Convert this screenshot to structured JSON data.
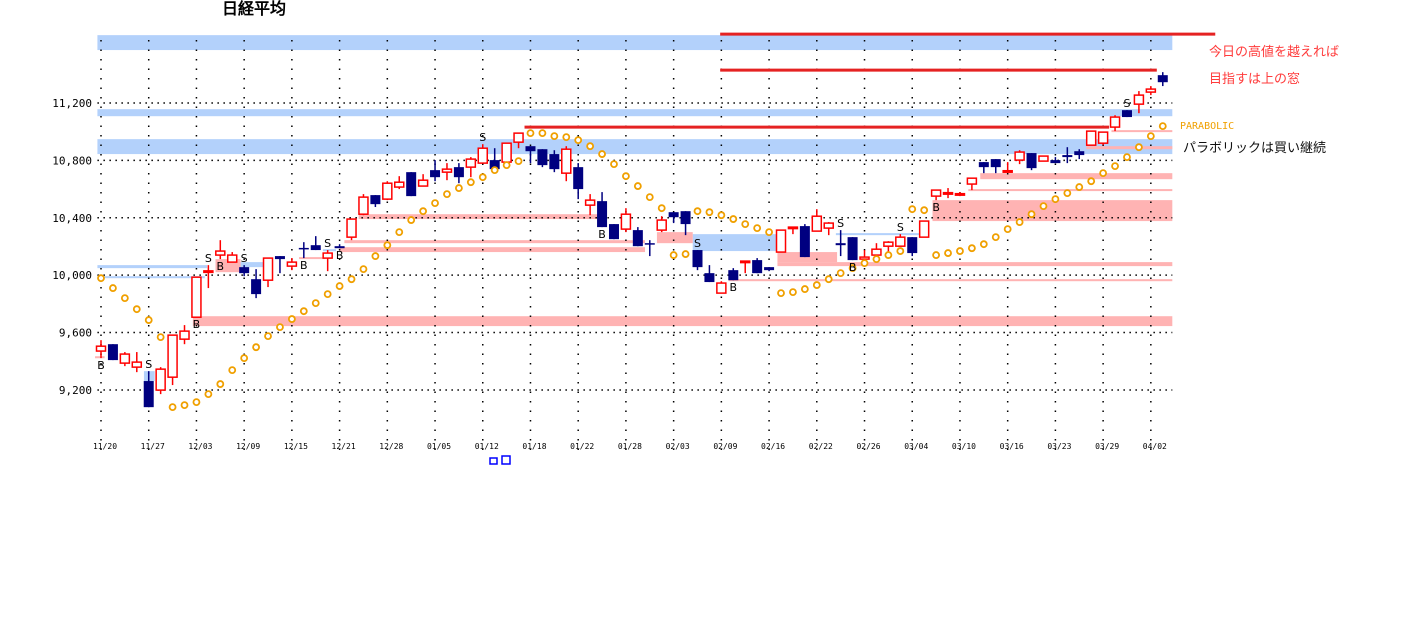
{
  "chart_data": {
    "type": "candlestick",
    "title": "日経平均",
    "ylim": [
      8900,
      11690
    ],
    "yticks": [
      9200,
      9600,
      10000,
      10400,
      10800,
      11200
    ],
    "ytick_labels": [
      "9,200",
      "9,600",
      "10,000",
      "10,400",
      "10,800",
      "11,200"
    ],
    "xtick_every": 4,
    "xtick_labels": [
      "11/20",
      "11/27",
      "12/03",
      "12/09",
      "12/15",
      "12/21",
      "12/28",
      "01/05",
      "01/12",
      "01/18",
      "01/22",
      "01/28",
      "02/03",
      "02/09",
      "02/16",
      "02/22",
      "02/26",
      "03/04",
      "03/10",
      "03/16",
      "03/23",
      "03/29",
      "04/02"
    ],
    "grid": true,
    "colors": {
      "up": "#ff0000",
      "down": "#000080",
      "sar": "#f0a000",
      "resistance_band": "#b3d1fb",
      "support_band": "#ffb3b3",
      "target_line": "#e52222"
    },
    "candles_ohlc": [
      [
        9471,
        9547,
        9422,
        9505
      ],
      [
        9519,
        9519,
        9408,
        9408
      ],
      [
        9387,
        9464,
        9366,
        9450
      ],
      [
        9359,
        9464,
        9324,
        9394
      ],
      [
        9262,
        9331,
        9080,
        9080
      ],
      [
        9199,
        9359,
        9171,
        9345
      ],
      [
        9289,
        9582,
        9234,
        9582
      ],
      [
        9554,
        9652,
        9519,
        9610
      ],
      [
        9707,
        9986,
        9707,
        9986
      ],
      [
        10028,
        10070,
        9910,
        10030
      ],
      [
        10140,
        10244,
        10112,
        10168
      ],
      [
        10091,
        10161,
        10091,
        10140
      ],
      [
        10056,
        10070,
        9993,
        10014
      ],
      [
        9972,
        10042,
        9840,
        9868
      ],
      [
        9965,
        10119,
        9917,
        10119
      ],
      [
        10133,
        10133,
        10014,
        10112
      ],
      [
        10063,
        10119,
        10035,
        10091
      ],
      [
        10190,
        10230,
        10119,
        10185
      ],
      [
        10209,
        10272,
        10175,
        10175
      ],
      [
        10119,
        10175,
        10028,
        10154
      ],
      [
        10202,
        10216,
        10188,
        10188
      ],
      [
        10265,
        10391,
        10244,
        10391
      ],
      [
        10425,
        10565,
        10418,
        10544
      ],
      [
        10558,
        10558,
        10475,
        10495
      ],
      [
        10530,
        10655,
        10523,
        10641
      ],
      [
        10614,
        10690,
        10600,
        10648
      ],
      [
        10718,
        10718,
        10551,
        10551
      ],
      [
        10621,
        10704,
        10621,
        10662
      ],
      [
        10732,
        10802,
        10655,
        10683
      ],
      [
        10718,
        10781,
        10662,
        10739
      ],
      [
        10753,
        10781,
        10641,
        10683
      ],
      [
        10753,
        10823,
        10683,
        10809
      ],
      [
        10781,
        10913,
        10781,
        10885
      ],
      [
        10802,
        10885,
        10739,
        10739
      ],
      [
        10788,
        10920,
        10788,
        10920
      ],
      [
        10927,
        10990,
        10885,
        10990
      ],
      [
        10899,
        10899,
        10781,
        10864
      ],
      [
        10878,
        10878,
        10753,
        10767
      ],
      [
        10844,
        10871,
        10718,
        10739
      ],
      [
        10711,
        10899,
        10655,
        10878
      ],
      [
        10753,
        10781,
        10530,
        10600
      ],
      [
        10488,
        10565,
        10418,
        10523
      ],
      [
        10516,
        10579,
        10335,
        10335
      ],
      [
        10356,
        10356,
        10251,
        10251
      ],
      [
        10321,
        10467,
        10300,
        10425
      ],
      [
        10314,
        10335,
        10202,
        10202
      ],
      [
        10223,
        10244,
        10133,
        10216
      ],
      [
        10314,
        10411,
        10300,
        10384
      ],
      [
        10439,
        10439,
        10363,
        10404
      ],
      [
        10446,
        10446,
        10279,
        10356
      ],
      [
        10175,
        10175,
        10035,
        10056
      ],
      [
        10014,
        10070,
        9952,
        9952
      ],
      [
        9875,
        9958,
        9875,
        9945
      ],
      [
        10035,
        10049,
        9965,
        9965
      ],
      [
        10091,
        10098,
        10014,
        10098
      ],
      [
        10105,
        10119,
        10014,
        10014
      ],
      [
        10056,
        10056,
        10028,
        10035
      ],
      [
        10161,
        10314,
        10161,
        10314
      ],
      [
        10328,
        10335,
        10286,
        10335
      ],
      [
        10342,
        10356,
        10126,
        10126
      ],
      [
        10307,
        10460,
        10307,
        10411
      ],
      [
        10328,
        10370,
        10279,
        10363
      ],
      [
        10223,
        10314,
        10133,
        10209
      ],
      [
        10265,
        10265,
        10105,
        10105
      ],
      [
        10112,
        10175,
        10112,
        10126
      ],
      [
        10140,
        10223,
        10140,
        10181
      ],
      [
        10202,
        10237,
        10154,
        10230
      ],
      [
        10202,
        10286,
        10202,
        10265
      ],
      [
        10265,
        10265,
        10133,
        10154
      ],
      [
        10265,
        10377,
        10265,
        10377
      ],
      [
        10551,
        10593,
        10523,
        10593
      ],
      [
        10572,
        10607,
        10537,
        10575
      ],
      [
        10565,
        10579,
        10551,
        10568
      ],
      [
        10635,
        10676,
        10593,
        10676
      ],
      [
        10788,
        10788,
        10711,
        10753
      ],
      [
        10809,
        10809,
        10711,
        10753
      ],
      [
        10725,
        10788,
        10718,
        10728
      ],
      [
        10802,
        10871,
        10774,
        10858
      ],
      [
        10851,
        10851,
        10732,
        10746
      ],
      [
        10795,
        10830,
        10795,
        10830
      ],
      [
        10802,
        10823,
        10781,
        10781
      ],
      [
        10837,
        10892,
        10781,
        10823
      ],
      [
        10864,
        10878,
        10809,
        10837
      ],
      [
        10906,
        11004,
        10906,
        11004
      ],
      [
        10920,
        10997,
        10906,
        10997
      ],
      [
        11032,
        11115,
        11004,
        11102
      ],
      [
        11150,
        11150,
        11102,
        11102
      ],
      [
        11192,
        11283,
        11129,
        11255
      ],
      [
        11276,
        11318,
        11255,
        11297
      ],
      [
        11394,
        11415,
        11318,
        11345
      ]
    ],
    "parabolic_sar": [
      9979,
      9910,
      9840,
      9763,
      9687,
      9568,
      9080,
      9094,
      9115,
      9171,
      9241,
      9338,
      9422,
      9498,
      9575,
      9638,
      9694,
      9749,
      9805,
      9868,
      9924,
      9972,
      10042,
      10133,
      10209,
      10300,
      10384,
      10446,
      10502,
      10565,
      10607,
      10648,
      10683,
      10732,
      10767,
      10795,
      10990,
      10990,
      10969,
      10962,
      10941,
      10899,
      10844,
      10774,
      10690,
      10621,
      10544,
      10467,
      10140,
      10147,
      10446,
      10439,
      10418,
      10391,
      10356,
      10328,
      10300,
      9875,
      9882,
      9903,
      9931,
      9972,
      10014,
      10049,
      10084,
      10112,
      10140,
      10168,
      10460,
      10453,
      10140,
      10154,
      10168,
      10188,
      10216,
      10265,
      10321,
      10370,
      10425,
      10481,
      10530,
      10572,
      10614,
      10655,
      10711,
      10760,
      10823,
      10892,
      10969,
      11039
    ],
    "signals": [
      {
        "index": 0,
        "type": "B"
      },
      {
        "index": 4,
        "type": "S"
      },
      {
        "index": 8,
        "type": "B"
      },
      {
        "index": 9,
        "type": "S"
      },
      {
        "index": 10,
        "type": "B"
      },
      {
        "index": 12,
        "type": "S"
      },
      {
        "index": 17,
        "type": "B"
      },
      {
        "index": 19,
        "type": "S"
      },
      {
        "index": 20,
        "type": "B"
      },
      {
        "index": 32,
        "type": "S"
      },
      {
        "index": 42,
        "type": "B"
      },
      {
        "index": 50,
        "type": "S"
      },
      {
        "index": 53,
        "type": "B"
      },
      {
        "index": 62,
        "type": "S"
      },
      {
        "index": 63,
        "type": "B"
      },
      {
        "index": 67,
        "type": "S"
      },
      {
        "index": 70,
        "type": "B"
      },
      {
        "index": 86,
        "type": "S"
      }
    ],
    "resistance_bands": [
      {
        "from": -0.3,
        "to": 89.8,
        "low": 11569,
        "high": 11673
      },
      {
        "from": -0.3,
        "to": 89.8,
        "low": 11108,
        "high": 11157
      },
      {
        "from": -0.3,
        "to": 89.8,
        "low": 10844,
        "high": 10948
      },
      {
        "from": -0.3,
        "to": 8.9,
        "low": 10049,
        "high": 10070
      },
      {
        "from": -0.3,
        "to": 8.7,
        "low": 9979,
        "high": 9993
      },
      {
        "from": 3.6,
        "to": 4.5,
        "low": 9262,
        "high": 9331
      },
      {
        "from": 11.7,
        "to": 13.7,
        "low": 10056,
        "high": 10091
      },
      {
        "from": 18.6,
        "to": 19.7,
        "low": 10168,
        "high": 10181
      },
      {
        "from": 31.6,
        "to": 34.5,
        "low": 10906,
        "high": 10920
      },
      {
        "from": 49.6,
        "to": 56.7,
        "low": 10168,
        "high": 10286
      },
      {
        "from": 61.6,
        "to": 68.7,
        "low": 10279,
        "high": 10293
      }
    ],
    "support_bands": [
      {
        "from": 7.7,
        "to": 89.8,
        "low": 9645,
        "high": 9714
      },
      {
        "from": -0.5,
        "to": 0.3,
        "low": 9422,
        "high": 9435
      },
      {
        "from": 9.6,
        "to": 11.7,
        "low": 10021,
        "high": 10112
      },
      {
        "from": 16.6,
        "to": 18.8,
        "low": 10112,
        "high": 10126
      },
      {
        "from": 20.4,
        "to": 45.6,
        "low": 10223,
        "high": 10244
      },
      {
        "from": 20.0,
        "to": 45.6,
        "low": 10161,
        "high": 10195
      },
      {
        "from": 21.6,
        "to": 41.7,
        "low": 10391,
        "high": 10425
      },
      {
        "from": 46.6,
        "to": 49.6,
        "low": 10223,
        "high": 10300
      },
      {
        "from": 56.7,
        "to": 61.7,
        "low": 10091,
        "high": 10161
      },
      {
        "from": 56.7,
        "to": 89.8,
        "low": 10063,
        "high": 10091
      },
      {
        "from": 52.6,
        "to": 89.8,
        "low": 9958,
        "high": 9972
      },
      {
        "from": 69.7,
        "to": 89.8,
        "low": 10377,
        "high": 10523
      },
      {
        "from": 72.7,
        "to": 89.8,
        "low": 10593,
        "high": 10600
      },
      {
        "from": 73.7,
        "to": 89.8,
        "low": 10669,
        "high": 10711
      },
      {
        "from": 82.6,
        "to": 89.8,
        "low": 10878,
        "high": 10899
      },
      {
        "from": 84.7,
        "to": 89.8,
        "low": 10997,
        "high": 11011
      }
    ],
    "target_lines": [
      {
        "from": 51.9,
        "to": 93.4,
        "price": 11680
      },
      {
        "from": 51.9,
        "to": 88.5,
        "price": 11429
      },
      {
        "from": 35.5,
        "to": 84.5,
        "price": 11032
      }
    ],
    "annotations": {
      "note_high": "今日の高値を越えれば",
      "note_target": "目指すは上の窓",
      "parabolic_label": "PARABOLIC",
      "parabolic_note": "パラボリックは買い継続"
    }
  }
}
